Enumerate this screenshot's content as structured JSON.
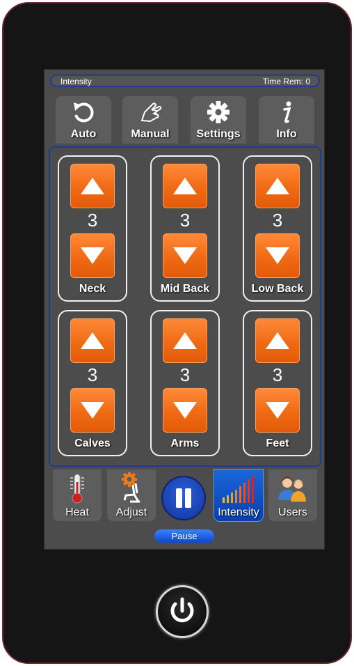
{
  "status": {
    "mode": "Intensity",
    "time_remaining": "Time Rem: 0"
  },
  "top_nav": [
    {
      "id": "auto",
      "label": "Auto",
      "icon": "refresh-icon"
    },
    {
      "id": "manual",
      "label": "Manual",
      "icon": "hand-icon"
    },
    {
      "id": "settings",
      "label": "Settings",
      "icon": "gear-icon"
    },
    {
      "id": "info",
      "label": "Info",
      "icon": "info-icon"
    }
  ],
  "zones": [
    {
      "id": "neck",
      "label": "Neck",
      "value": "3"
    },
    {
      "id": "mid-back",
      "label": "Mid Back",
      "value": "3"
    },
    {
      "id": "low-back",
      "label": "Low Back",
      "value": "3"
    },
    {
      "id": "calves",
      "label": "Calves",
      "value": "3"
    },
    {
      "id": "arms",
      "label": "Arms",
      "value": "3"
    },
    {
      "id": "feet",
      "label": "Feet",
      "value": "3"
    }
  ],
  "bottom_nav": [
    {
      "id": "heat",
      "label": "Heat",
      "icon": "thermometer-icon"
    },
    {
      "id": "adjust",
      "label": "Adjust",
      "icon": "chair-adjust-icon"
    },
    {
      "id": "intensity",
      "label": "Intensity",
      "icon": "intensity-bars-icon",
      "active": true
    },
    {
      "id": "users",
      "label": "Users",
      "icon": "users-icon"
    }
  ],
  "pause": {
    "label": "Pause"
  },
  "colors": {
    "accent_orange": "#f06a14",
    "frame_blue": "#1d3f8a",
    "active_blue": "#0a3fb0",
    "screen_bg": "#4c4c4c"
  }
}
